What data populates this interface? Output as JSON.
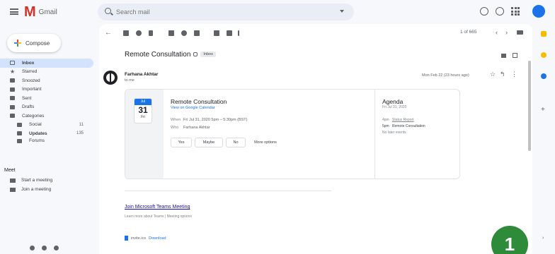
{
  "app": {
    "logo_letter": "M",
    "logo_text": "Gmail"
  },
  "search": {
    "placeholder": "Search mail"
  },
  "compose": {
    "label": "Compose"
  },
  "nav": [
    {
      "label": "Inbox",
      "active": true
    },
    {
      "label": "Starred"
    },
    {
      "label": "Snoozed"
    },
    {
      "label": "Important"
    },
    {
      "label": "Sent"
    },
    {
      "label": "Drafts"
    },
    {
      "label": "Categories"
    }
  ],
  "categories": [
    {
      "label": "Social",
      "count": "11"
    },
    {
      "label": "Updates",
      "count": "135"
    },
    {
      "label": "Forums",
      "count": ""
    }
  ],
  "meet": {
    "heading": "Meet",
    "items": [
      "Start a meeting",
      "Join a meeting"
    ]
  },
  "toolbar": {
    "page_info": "1 of 665"
  },
  "email": {
    "subject": "Remote Consultation",
    "label": "Inbox",
    "sender_name": "Farhana Akhtar",
    "sender_to": "to me",
    "date": "Mon Feb 22 (23 hours ago)"
  },
  "event": {
    "month": "Jul",
    "day": "31",
    "dow": "Fri",
    "title": "Remote Consultation",
    "calendar_link": "View on Google Calendar",
    "when_label": "When",
    "when_value": "Fri Jul 31, 2020 5pm – 5:30pm (BST)",
    "who_label": "Who",
    "who_value": "Farhana Akhtar",
    "rsvp": [
      "Yes",
      "Maybe",
      "No",
      "More options"
    ]
  },
  "agenda": {
    "title": "Agenda",
    "date": "Fri Jul 31, 2020",
    "rows": [
      {
        "time": "4pm",
        "text": "Status Report"
      },
      {
        "time": "5pm",
        "text": "Remote Consultation"
      }
    ],
    "note": "No later events"
  },
  "body": {
    "teams_link": "Join Microsoft Teams Meeting",
    "teams_sub": "Learn more about Teams | Meeting options",
    "attachment_name": "invite.ics",
    "attachment_action": "Download"
  },
  "step_badge": "1",
  "colors": {
    "accent": "#1a73e8",
    "logo_red": "#d93025",
    "badge_green": "#2e8b3a"
  }
}
